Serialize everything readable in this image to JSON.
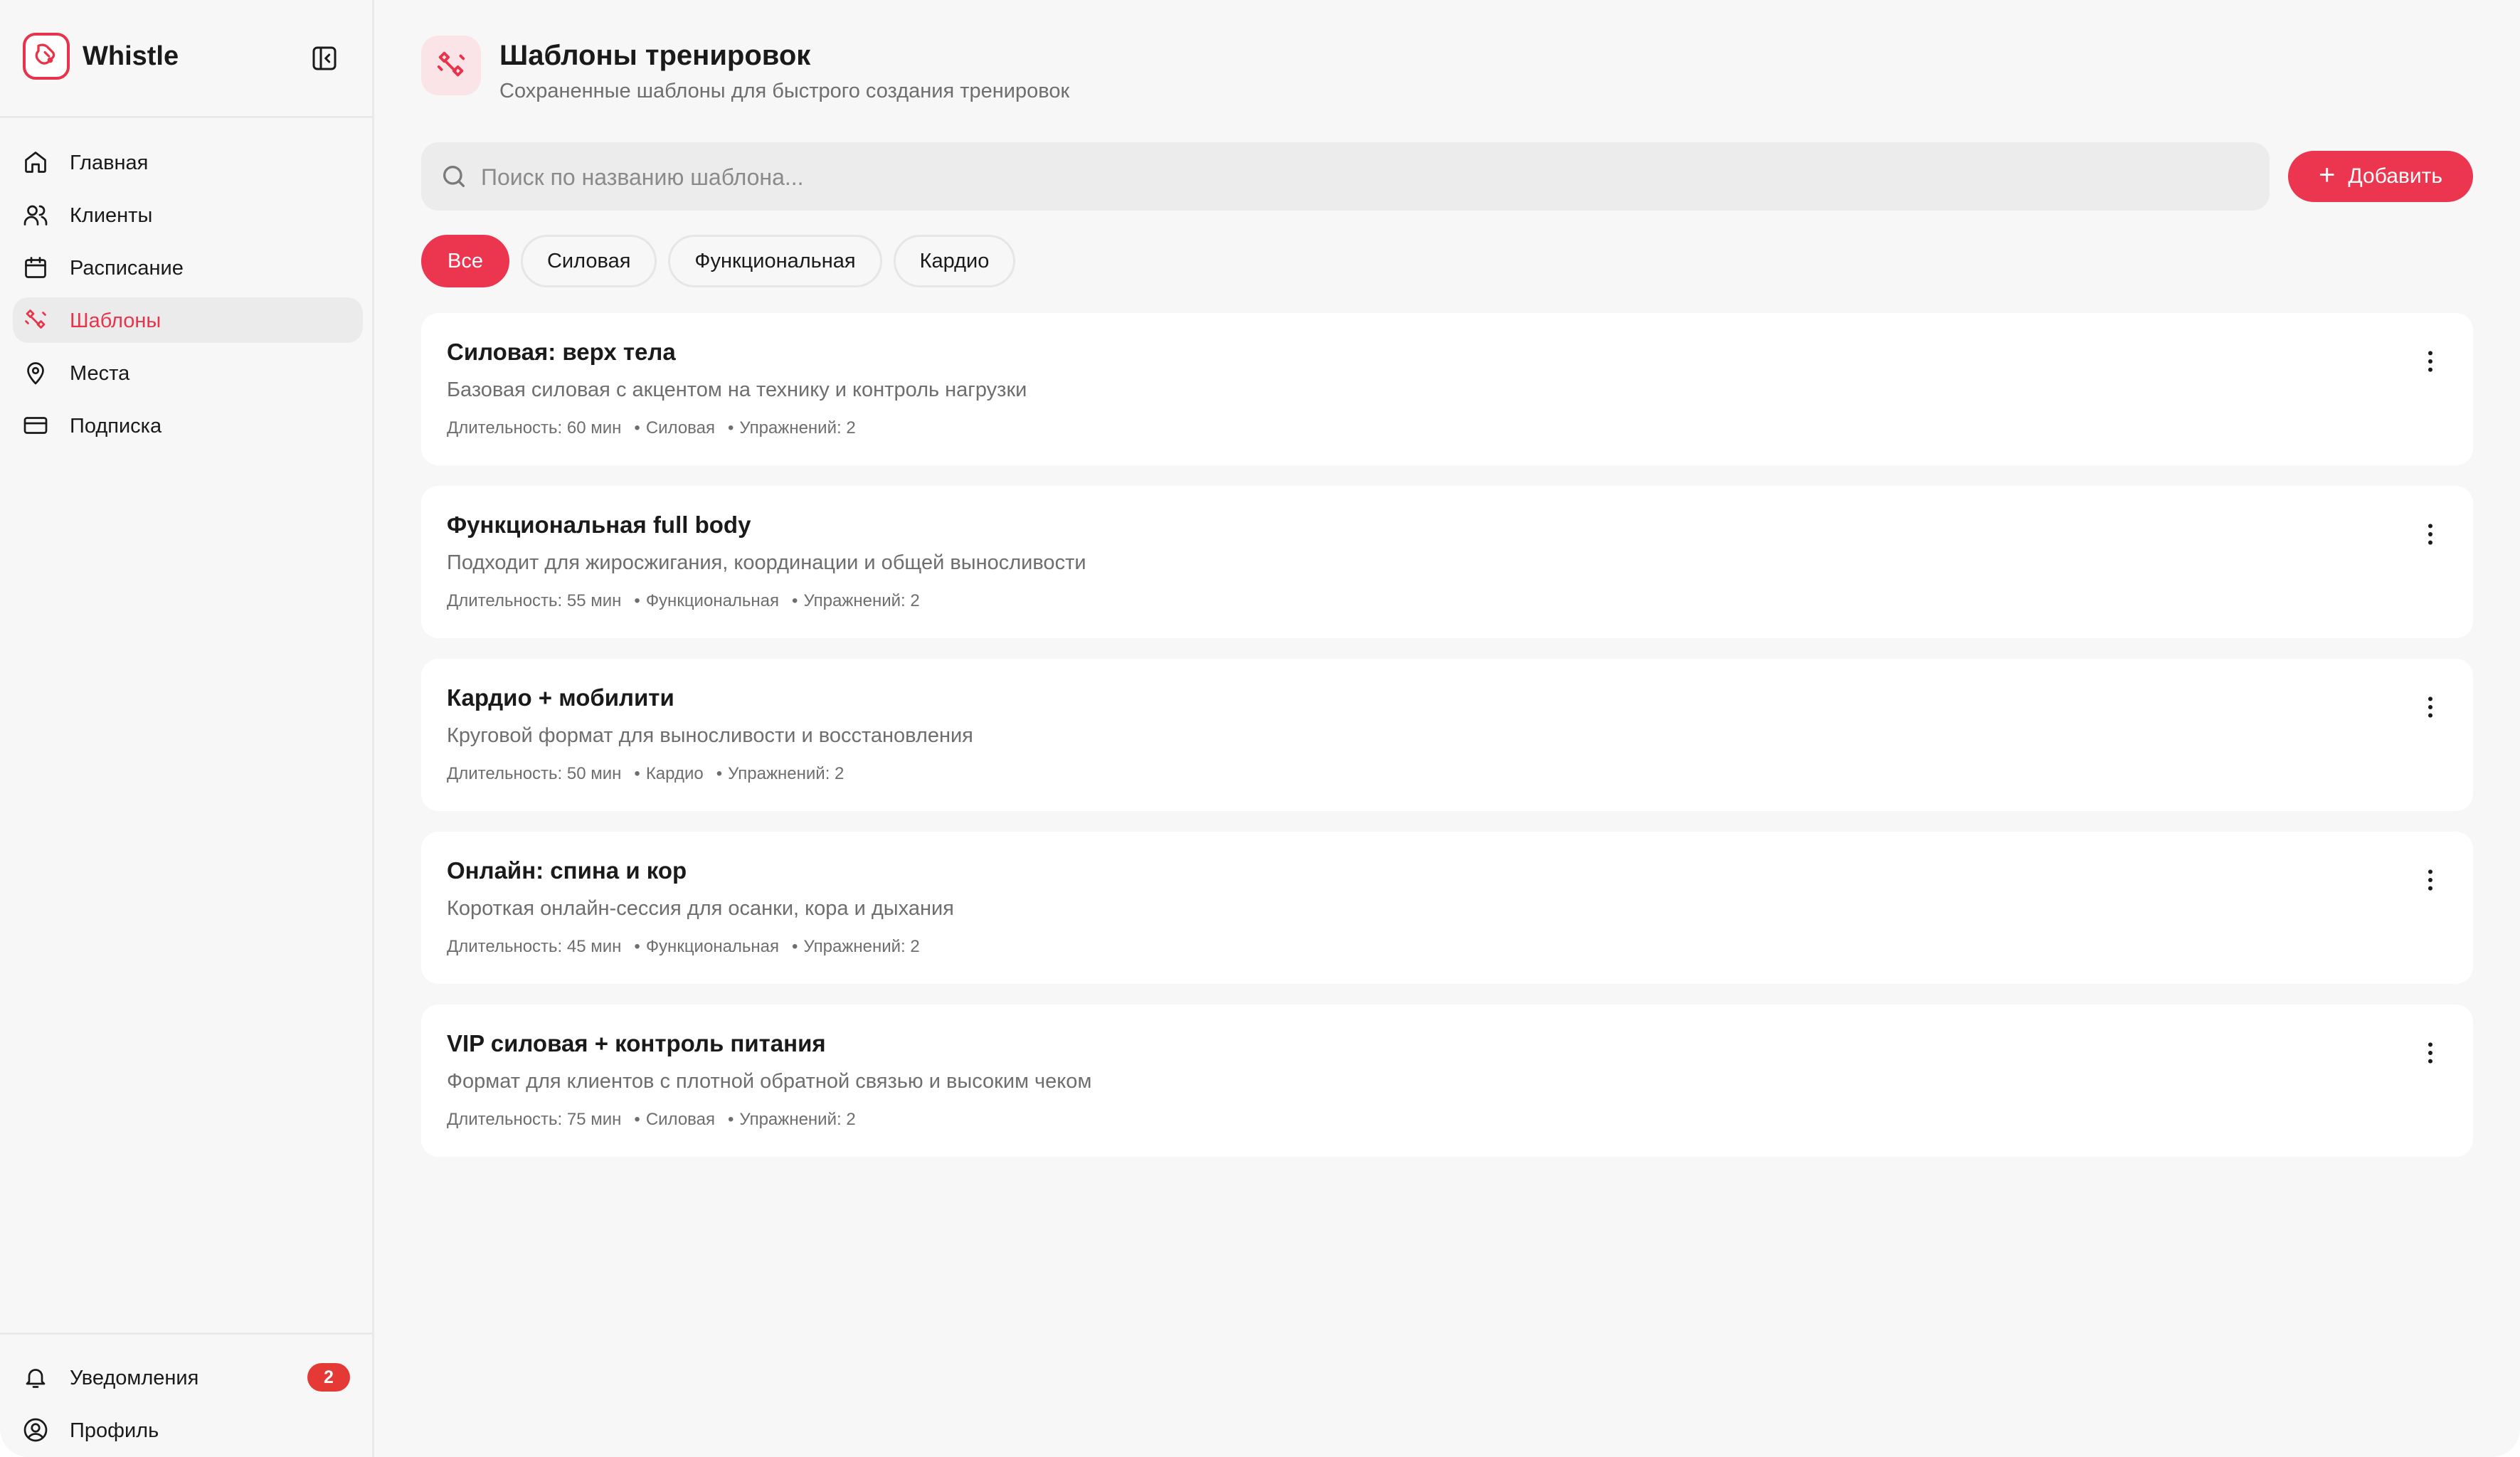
{
  "brand": {
    "name": "Whistle"
  },
  "sidebar": {
    "items": [
      {
        "label": "Главная",
        "icon": "home-icon",
        "active": false
      },
      {
        "label": "Клиенты",
        "icon": "users-icon",
        "active": false
      },
      {
        "label": "Расписание",
        "icon": "calendar-icon",
        "active": false
      },
      {
        "label": "Шаблоны",
        "icon": "templates-icon",
        "active": true
      },
      {
        "label": "Места",
        "icon": "map-pin-icon",
        "active": false
      },
      {
        "label": "Подписка",
        "icon": "credit-card-icon",
        "active": false
      }
    ],
    "bottom": {
      "notifications_label": "Уведомления",
      "notifications_count": "2",
      "profile_label": "Профиль"
    }
  },
  "header": {
    "title": "Шаблоны тренировок",
    "subtitle": "Сохраненные шаблоны для быстрого создания тренировок"
  },
  "search": {
    "placeholder": "Поиск по названию шаблона...",
    "value": ""
  },
  "add_button": {
    "label": "Добавить"
  },
  "filters": [
    {
      "label": "Все",
      "active": true
    },
    {
      "label": "Силовая",
      "active": false
    },
    {
      "label": "Функциональная",
      "active": false
    },
    {
      "label": "Кардио",
      "active": false
    }
  ],
  "templates": [
    {
      "title": "Силовая: верх тела",
      "description": "Базовая силовая с акцентом на технику и контроль нагрузки",
      "duration": "Длительность: 60 мин",
      "type": "Силовая",
      "exercises": "Упражнений: 2"
    },
    {
      "title": "Функциональная full body",
      "description": "Подходит для жиросжигания, координации и общей выносливости",
      "duration": "Длительность: 55 мин",
      "type": "Функциональная",
      "exercises": "Упражнений: 2"
    },
    {
      "title": "Кардио + мобилити",
      "description": "Круговой формат для выносливости и восстановления",
      "duration": "Длительность: 50 мин",
      "type": "Кардио",
      "exercises": "Упражнений: 2"
    },
    {
      "title": "Онлайн: спина и кор",
      "description": "Короткая онлайн-сессия для осанки, кора и дыхания",
      "duration": "Длительность: 45 мин",
      "type": "Функциональная",
      "exercises": "Упражнений: 2"
    },
    {
      "title": "VIP силовая + контроль питания",
      "description": "Формат для клиентов с плотной обратной связью и высоким чеком",
      "duration": "Длительность: 75 мин",
      "type": "Силовая",
      "exercises": "Упражнений: 2"
    }
  ],
  "colors": {
    "accent": "#ec3650",
    "active_nav_text": "#e8344a",
    "badge": "#e53935"
  }
}
